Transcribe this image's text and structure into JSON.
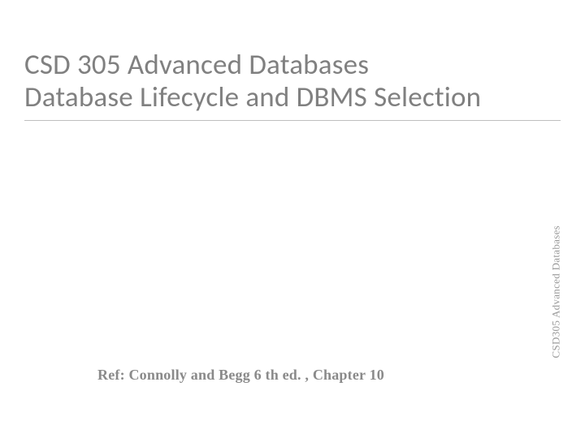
{
  "title": {
    "line1": "CSD 305 Advanced Databases",
    "line2": "Database Lifecycle and DBMS Selection"
  },
  "side_label": "CSD305 Advanced Databases",
  "reference": "Ref: Connolly and Begg 6 th ed. , Chapter 10"
}
